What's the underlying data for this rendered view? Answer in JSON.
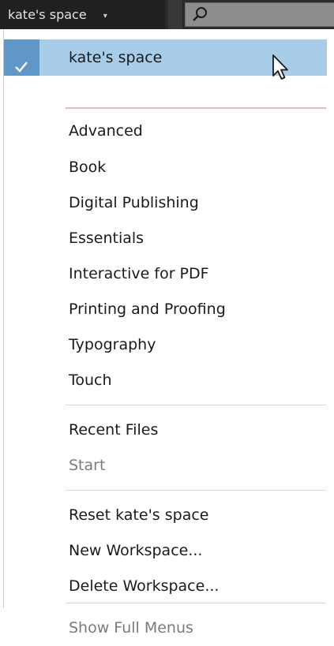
{
  "topbar": {
    "workspace_label": "kate's space",
    "caret_icon": "▾",
    "search_icon": "search-icon"
  },
  "menu": {
    "current": {
      "label": "kate's space",
      "checked": true,
      "icon": "check-icon"
    },
    "workspaces": [
      {
        "label": "Advanced"
      },
      {
        "label": "Book"
      },
      {
        "label": "Digital Publishing"
      },
      {
        "label": "Essentials"
      },
      {
        "label": "Interactive for PDF"
      },
      {
        "label": "Printing and Proofing"
      },
      {
        "label": "Typography"
      },
      {
        "label": "Touch"
      }
    ],
    "recent": [
      {
        "label": "Recent Files",
        "enabled": true
      },
      {
        "label": "Start",
        "enabled": false
      }
    ],
    "actions": [
      {
        "label": "Reset kate's space"
      },
      {
        "label": "New Workspace..."
      },
      {
        "label": "Delete Workspace..."
      }
    ],
    "footer": {
      "label": "Show Full Menus",
      "enabled": false
    }
  },
  "colors": {
    "highlight": "#a8cde8",
    "check_column": "#5f97c8",
    "topbar": "#202020"
  }
}
